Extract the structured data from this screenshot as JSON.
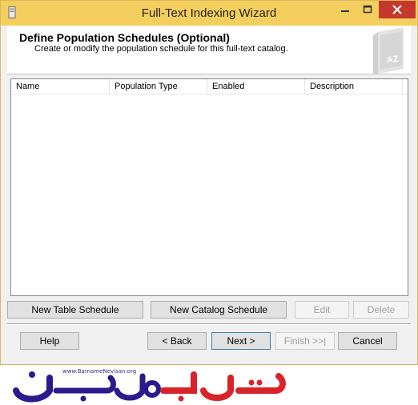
{
  "window": {
    "title": "Full-Text Indexing Wizard"
  },
  "header": {
    "title": "Define Population Schedules (Optional)",
    "subtitle": "Create or modify the population schedule for this full-text catalog.",
    "art_text": "AZ"
  },
  "list": {
    "columns": [
      "Name",
      "Population Type",
      "Enabled",
      "Description"
    ],
    "rows": []
  },
  "action_buttons": {
    "new_table_schedule": "New Table Schedule",
    "new_catalog_schedule": "New Catalog Schedule",
    "edit": "Edit",
    "delete": "Delete"
  },
  "nav_buttons": {
    "help": "Help",
    "back": "< Back",
    "next": "Next >",
    "finish": "Finish >>|",
    "cancel": "Cancel"
  },
  "watermark": {
    "url": "www.BarnameNevisan.org"
  },
  "colors": {
    "titlebar": "#f5cf5e",
    "close": "#c7382c",
    "watermark_blue": "#2a1a8c",
    "watermark_red": "#d8232a"
  }
}
